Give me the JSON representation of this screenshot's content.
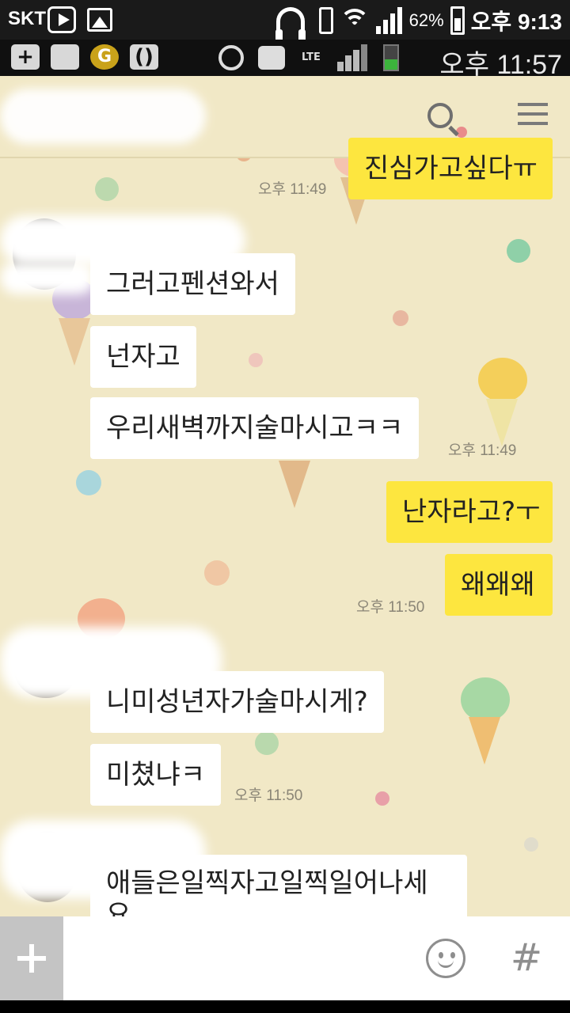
{
  "status_bar": {
    "carrier": "SKT",
    "battery": "62%",
    "time": "오후 9:13"
  },
  "photo_status_bar": {
    "left_badges": [
      "+",
      "",
      "G",
      "()"
    ],
    "network": "LTE",
    "time": "오후 11:57"
  },
  "chat_header": {
    "title": ""
  },
  "messages": [
    {
      "side": "out",
      "text": "진심가고싶다ㅠ",
      "time": "오후 11:49"
    },
    {
      "side": "in",
      "text": "그러고펜션와서",
      "time": ""
    },
    {
      "side": "in",
      "text": "넌자고",
      "time": ""
    },
    {
      "side": "in",
      "text": "우리새벽까지술마시고ㅋㅋ",
      "time": "오후 11:49"
    },
    {
      "side": "out",
      "text": "난자라고?ㅜ",
      "time": ""
    },
    {
      "side": "out",
      "text": "왜왜왜",
      "time": "오후 11:50"
    },
    {
      "side": "in",
      "text": "니미성년자가술마시게?",
      "time": ""
    },
    {
      "side": "in",
      "text": "미쳤냐ㅋ",
      "time": "오후 11:50"
    },
    {
      "side": "in",
      "text": "애들은일찍자고일찍일어나세요",
      "time": ""
    }
  ],
  "input_bar": {
    "plus": "+",
    "placeholder": "",
    "hash": "#"
  },
  "colors": {
    "chat_background": "#f1e8c6",
    "outgoing_bubble": "#fde63f",
    "incoming_bubble": "#ffffff"
  },
  "icons": [
    "play-icon",
    "image-icon",
    "headset-icon",
    "phone-icon",
    "wifi-icon",
    "signal-icon",
    "battery-icon",
    "alarm-icon",
    "bbm-icon",
    "search-icon",
    "menu-icon",
    "emoticon-icon"
  ]
}
